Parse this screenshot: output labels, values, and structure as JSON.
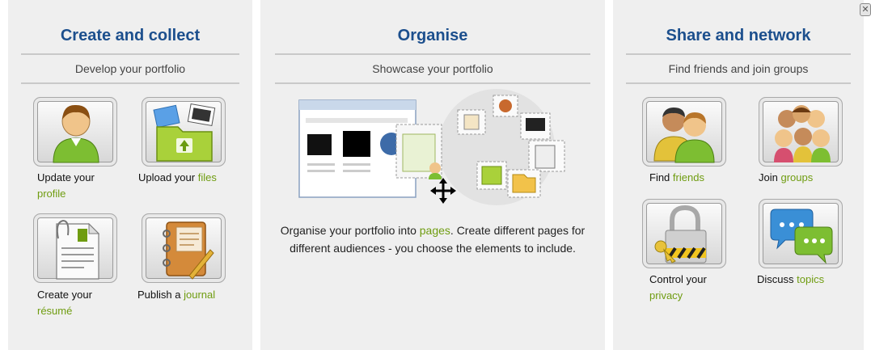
{
  "sections": {
    "create": {
      "title": "Create and collect",
      "subtitle": "Develop your portfolio",
      "items": [
        {
          "text": "Update your",
          "link": "profile",
          "icon": "profile-person-icon"
        },
        {
          "text": "Upload your",
          "link": "files",
          "icon": "files-folder-icon"
        },
        {
          "text": "Create your",
          "link": "résumé",
          "icon": "resume-document-icon"
        },
        {
          "text": "Publish a",
          "link": "journal",
          "icon": "journal-notebook-icon"
        }
      ]
    },
    "organise": {
      "title": "Organise",
      "subtitle": "Showcase your portfolio",
      "illustration": "portfolio-pages-illustration",
      "text_before": "Organise your portfolio into",
      "link": "pages",
      "text_after": ". Create different pages for different audiences - you choose the elements to include."
    },
    "share": {
      "title": "Share and network",
      "subtitle": "Find friends and join groups",
      "items": [
        {
          "text": "Find",
          "link": "friends",
          "icon": "friends-people-icon"
        },
        {
          "text": "Join",
          "link": "groups",
          "icon": "groups-people-icon"
        },
        {
          "text": "Control your",
          "link": "privacy",
          "icon": "privacy-padlock-icon"
        },
        {
          "text": "Discuss",
          "link": "topics",
          "icon": "topics-speech-bubbles-icon"
        }
      ]
    }
  },
  "close_button": "✕",
  "colors": {
    "title": "#1c4f8d",
    "link": "#6f9c10",
    "panel": "#efefef"
  }
}
